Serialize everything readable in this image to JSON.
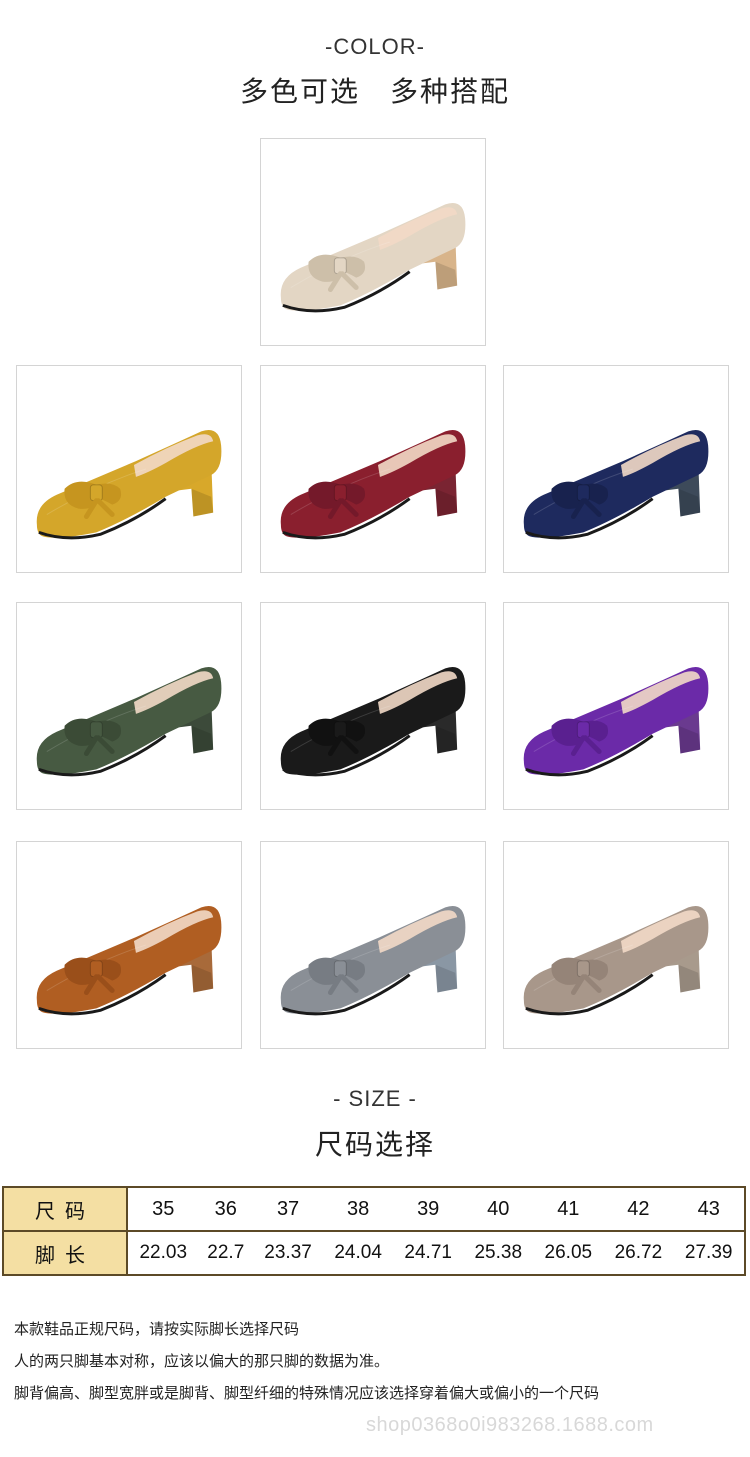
{
  "color_section": {
    "label": "-COLOR-",
    "title": "多色可选　多种搭配",
    "swatches": [
      {
        "color": "#e3d6c4",
        "heel": "#d8b48a",
        "bow": "#cdbfa9"
      },
      {
        "color": "#d4a62a",
        "heel": "#d8a82a",
        "bow": "#c6951f"
      },
      {
        "color": "#8a1f2e",
        "heel": "#7a2432",
        "bow": "#74192a"
      },
      {
        "color": "#1e2a5e",
        "heel": "#3d4a5a",
        "bow": "#18224e"
      },
      {
        "color": "#475a42",
        "heel": "#3c4a3a",
        "bow": "#3b4b36"
      },
      {
        "color": "#1a1a1a",
        "heel": "#2a2a2a",
        "bow": "#111111"
      },
      {
        "color": "#6b2aa8",
        "heel": "#6a3a8f",
        "bow": "#5a2090"
      },
      {
        "color": "#b05e22",
        "heel": "#a86a3a",
        "bow": "#9a4f1a"
      },
      {
        "color": "#8a8f96",
        "heel": "#8a97a4",
        "bow": "#777c83"
      },
      {
        "color": "#a8978a",
        "heel": "#a89a8c",
        "bow": "#958478"
      }
    ]
  },
  "size_section": {
    "label": "- SIZE -",
    "title": "尺码选择",
    "table": {
      "size_header": "尺码",
      "length_header": "脚长",
      "sizes": [
        "35",
        "36",
        "37",
        "38",
        "39",
        "40",
        "41",
        "42",
        "43"
      ],
      "lengths": [
        "22.03",
        "22.7",
        "23.37",
        "24.04",
        "24.71",
        "25.38",
        "26.05",
        "26.72",
        "27.39"
      ]
    }
  },
  "notes": [
    "本款鞋品正规尺码，请按实际脚长选择尺码",
    "人的两只脚基本对称，应该以偏大的那只脚的数据为准。",
    "脚背偏高、脚型宽胖或是脚背、脚型纤细的特殊情况应该选择穿着偏大或偏小的一个尺码"
  ],
  "watermark": "shop0368o0i983268.1688.com"
}
